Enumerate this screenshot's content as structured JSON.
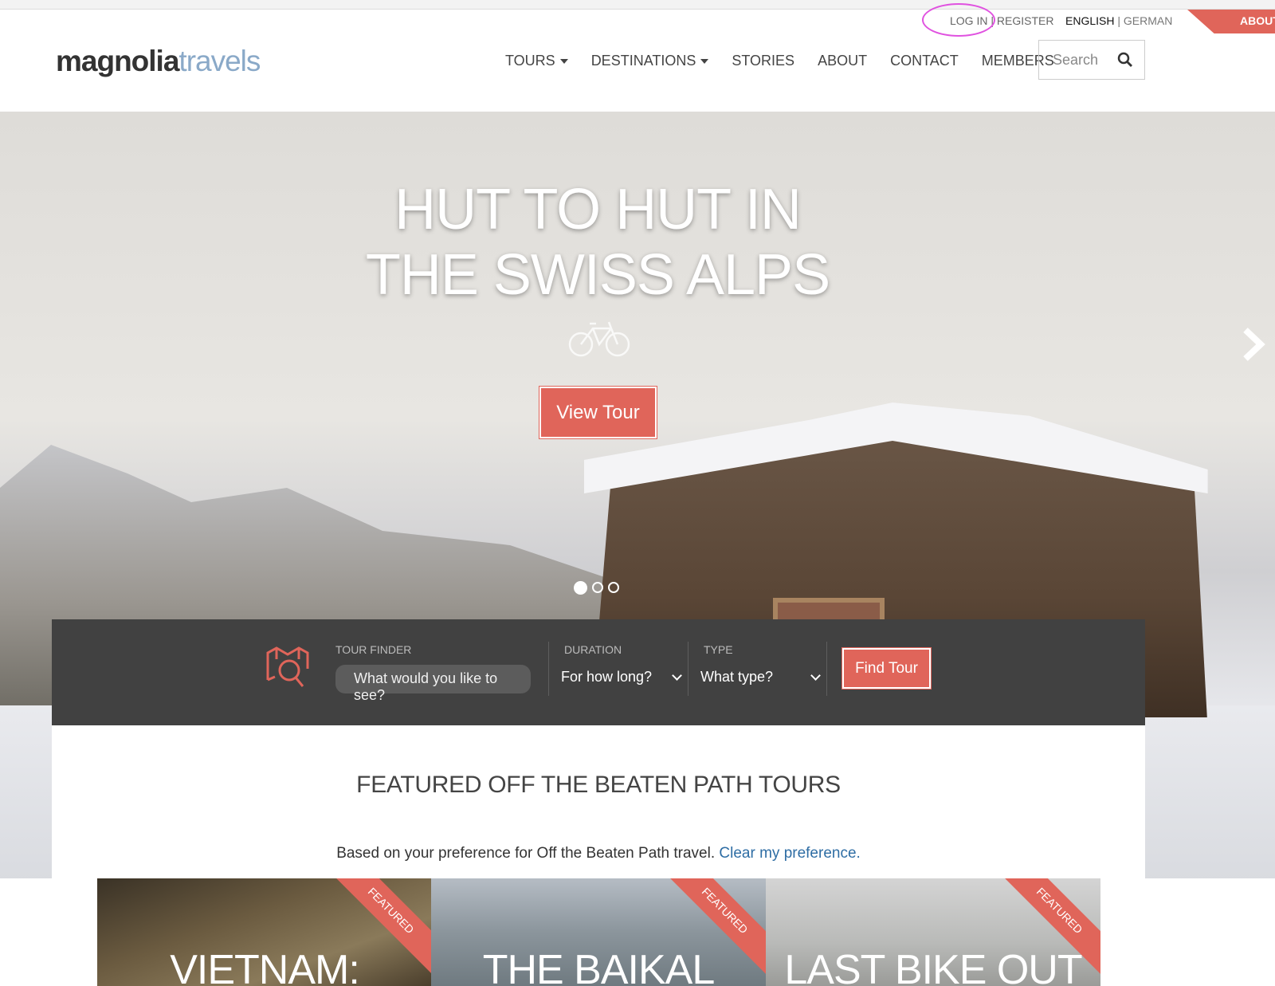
{
  "topbar": {
    "login": "LOG IN",
    "register": "REGISTER",
    "lang_active": "ENGLISH",
    "lang_other": "GERMAN",
    "about_tab": "ABOUT"
  },
  "logo": {
    "part1": "magnolia",
    "part2": "travels"
  },
  "nav": {
    "items": [
      "TOURS",
      "DESTINATIONS",
      "STORIES",
      "ABOUT",
      "CONTACT",
      "MEMBERS"
    ]
  },
  "search": {
    "placeholder": "Search"
  },
  "hero": {
    "title_line1": "HUT TO HUT IN",
    "title_line2": "THE SWISS ALPS",
    "button": "View Tour",
    "slides": 3,
    "active_slide": 1
  },
  "finder": {
    "tour_label": "TOUR FINDER",
    "tour_placeholder": "What would you like to see?",
    "duration_label": "DURATION",
    "duration_value": "For how long?",
    "type_label": "TYPE",
    "type_value": "What type?",
    "button": "Find Tour"
  },
  "featured": {
    "heading": "FEATURED OFF THE BEATEN PATH TOURS",
    "pref_text": "Based on your preference for Off the Beaten Path travel.",
    "pref_link": "Clear my preference.",
    "cards": [
      {
        "title": "VIETNAM:",
        "badge": "FEATURED"
      },
      {
        "title": "THE BAIKAL",
        "badge": "FEATURED"
      },
      {
        "title": "LAST BIKE OUT",
        "badge": "FEATURED"
      }
    ]
  },
  "colors": {
    "accent": "#e0655a",
    "finder_bg": "#414141",
    "link": "#2e6da4"
  }
}
